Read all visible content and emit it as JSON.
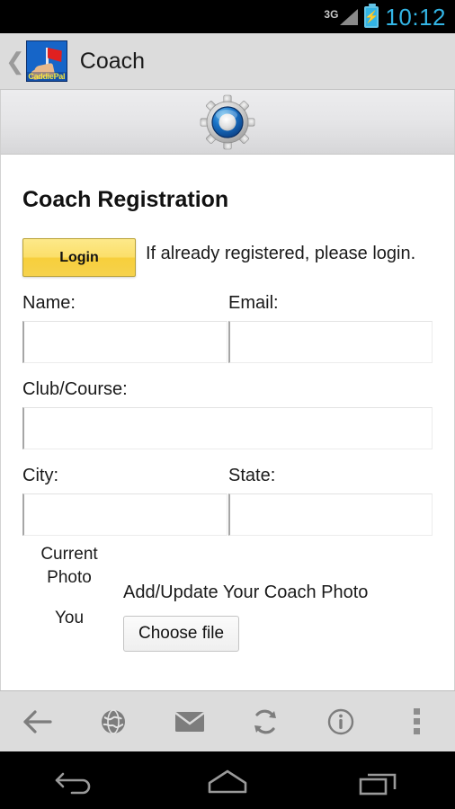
{
  "statusbar": {
    "network_label": "3G",
    "clock": "10:12",
    "battery_icon": "battery-charging-icon",
    "signal_icon": "signal-bars-icon"
  },
  "appbar": {
    "back_icon": "back-caret-icon",
    "logo_text": "CaddiePal",
    "logo_icon": "caddiepal-logo-icon",
    "title": "Coach"
  },
  "banner": {
    "icon": "gear-settings-icon"
  },
  "page": {
    "title": "Coach Registration",
    "login_button": "Login",
    "login_hint": "If already registered, please login.",
    "fields": {
      "name": {
        "label": "Name:",
        "value": "",
        "placeholder": ""
      },
      "email": {
        "label": "Email:",
        "value": "",
        "placeholder": ""
      },
      "club": {
        "label": "Club/Course:",
        "value": "",
        "placeholder": ""
      },
      "city": {
        "label": "City:",
        "value": "",
        "placeholder": ""
      },
      "state": {
        "label": "State:",
        "value": "",
        "placeholder": ""
      }
    },
    "photo": {
      "current_line1": "Current",
      "current_line2": "Photo",
      "current_line3": "You",
      "caption": "Add/Update Your Coach Photo",
      "choose_file_button": "Choose file"
    }
  },
  "toolbar": {
    "items": [
      {
        "name": "back-arrow-icon",
        "label": "Back"
      },
      {
        "name": "globe-icon",
        "label": "Browser"
      },
      {
        "name": "envelope-icon",
        "label": "Mail"
      },
      {
        "name": "refresh-icon",
        "label": "Refresh"
      },
      {
        "name": "info-icon",
        "label": "Info"
      },
      {
        "name": "overflow-menu-icon",
        "label": "More"
      }
    ]
  },
  "navbar": {
    "items": [
      {
        "name": "android-back-icon",
        "label": "Back"
      },
      {
        "name": "android-home-icon",
        "label": "Home"
      },
      {
        "name": "android-recents-icon",
        "label": "Recents"
      }
    ]
  },
  "colors": {
    "accent_blue": "#33b5e5",
    "login_yellow": "#f7cf3c",
    "chrome_gray": "#dcdcdc"
  }
}
